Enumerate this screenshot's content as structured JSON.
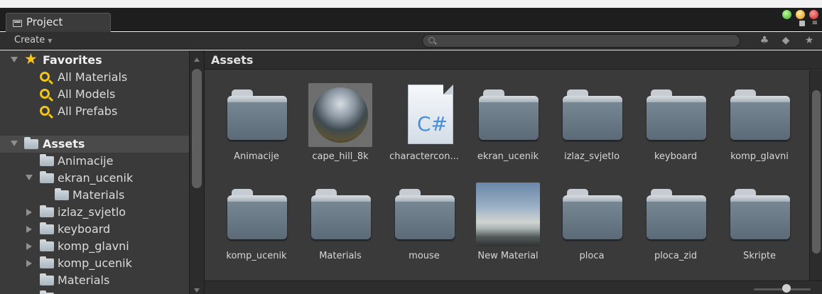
{
  "window": {
    "tab_label": "Project"
  },
  "toolbar": {
    "create_label": "Create",
    "search_placeholder": ""
  },
  "favorites": {
    "title": "Favorites",
    "items": [
      "All Materials",
      "All Models",
      "All Prefabs"
    ]
  },
  "assets_tree": {
    "root": "Assets",
    "items": [
      {
        "label": "Animacije",
        "depth": 1,
        "arrow": "none"
      },
      {
        "label": "ekran_ucenik",
        "depth": 1,
        "arrow": "down"
      },
      {
        "label": "Materials",
        "depth": 2,
        "arrow": "none"
      },
      {
        "label": "izlaz_svjetlo",
        "depth": 1,
        "arrow": "right"
      },
      {
        "label": "keyboard",
        "depth": 1,
        "arrow": "right"
      },
      {
        "label": "komp_glavni",
        "depth": 1,
        "arrow": "right"
      },
      {
        "label": "komp_ucenik",
        "depth": 1,
        "arrow": "right"
      },
      {
        "label": "Materials",
        "depth": 1,
        "arrow": "none"
      }
    ]
  },
  "main": {
    "breadcrumb": "Assets",
    "assets": [
      {
        "label": "Animacije",
        "icon": "folder-icon"
      },
      {
        "label": "cape_hill_8k",
        "icon": "sphere-preview-icon"
      },
      {
        "label": "charactercon...",
        "icon": "csharp-script-icon"
      },
      {
        "label": "ekran_ucenik",
        "icon": "folder-icon"
      },
      {
        "label": "izlaz_svjetlo",
        "icon": "folder-icon"
      },
      {
        "label": "keyboard",
        "icon": "folder-icon"
      },
      {
        "label": "komp_glavni",
        "icon": "folder-icon"
      },
      {
        "label": "komp_ucenik",
        "icon": "folder-icon"
      },
      {
        "label": "Materials",
        "icon": "folder-icon"
      },
      {
        "label": "mouse",
        "icon": "folder-icon"
      },
      {
        "label": "New Material",
        "icon": "material-sky-preview-icon"
      },
      {
        "label": "ploca",
        "icon": "folder-icon"
      },
      {
        "label": "ploca_zid",
        "icon": "folder-icon"
      },
      {
        "label": "Skripte",
        "icon": "folder-icon"
      }
    ],
    "csharp_glyph": "C#"
  }
}
